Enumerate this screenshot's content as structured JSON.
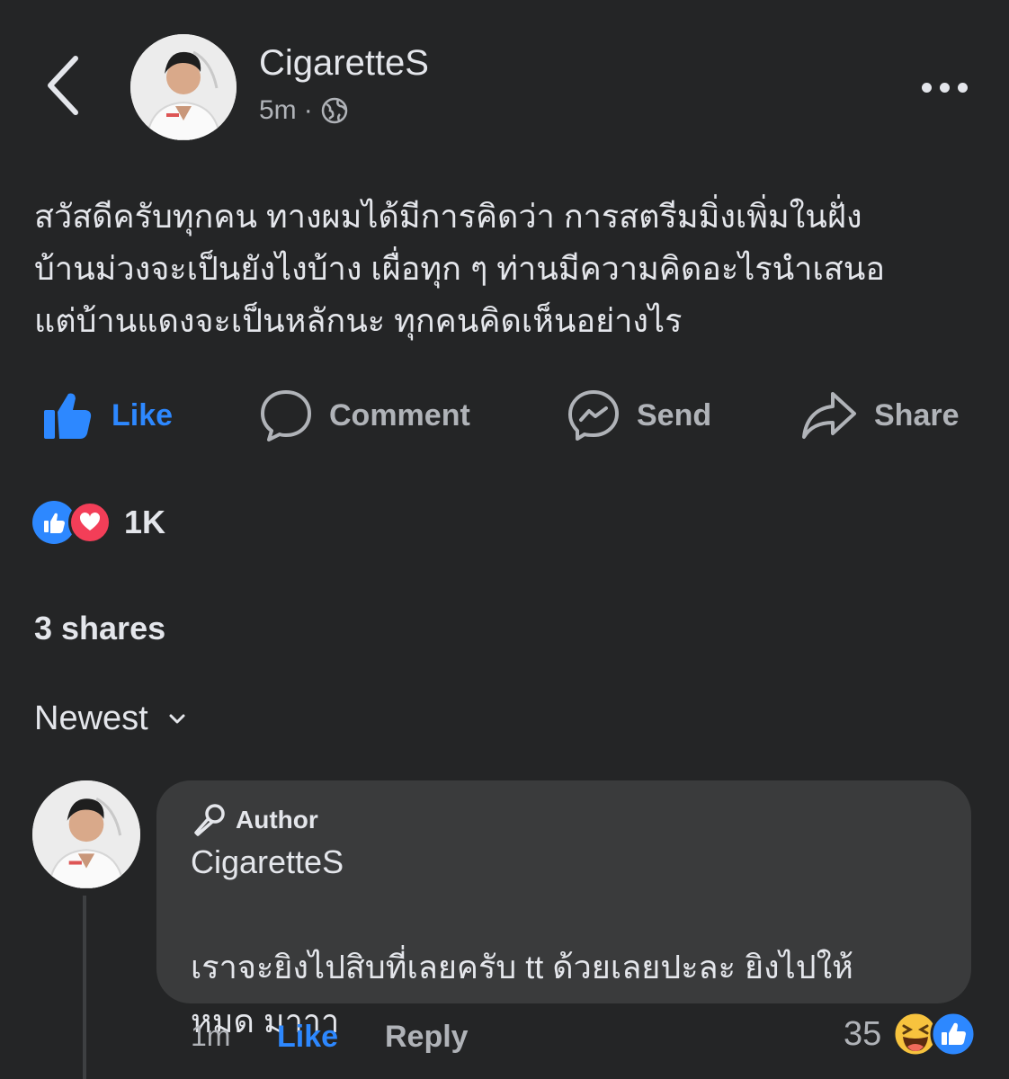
{
  "header": {
    "author_name": "CigaretteS",
    "time": "5m",
    "separator": "·",
    "audience_icon": "globe-icon"
  },
  "post": {
    "text": "สวัสดีครับทุกคน ทางผมได้มีการคิดว่า การสตรีมมิ่งเพิ่มในฝั่ง\nบ้านม่วงจะเป็นยังไงบ้าง เผื่อทุก ๆ ท่านมีความคิดอะไรนำเสนอ\nแต่บ้านแดงจะเป็นหลักนะ ทุกคนคิดเห็นอย่างไร"
  },
  "actions": {
    "like": "Like",
    "comment": "Comment",
    "send": "Send",
    "share": "Share"
  },
  "reactions": {
    "count": "1K",
    "types": [
      "like",
      "love"
    ]
  },
  "shares": "3 shares",
  "sort": {
    "label": "Newest"
  },
  "comment": {
    "badge": "Author",
    "name": "CigaretteS",
    "text": "เราจะยิงไปสิบที่เลยครับ tt ด้วยเลยปะละ ยิงไปให้\nหมด มาาา",
    "time": "1m",
    "like": "Like",
    "reply": "Reply",
    "reaction_count": "35",
    "reaction_types": [
      "haha",
      "like"
    ]
  },
  "colors": {
    "background": "#242526",
    "bubble": "#3a3b3c",
    "accent": "#2d88ff",
    "secondary_text": "#b0b3b8",
    "love": "#f33e58"
  }
}
